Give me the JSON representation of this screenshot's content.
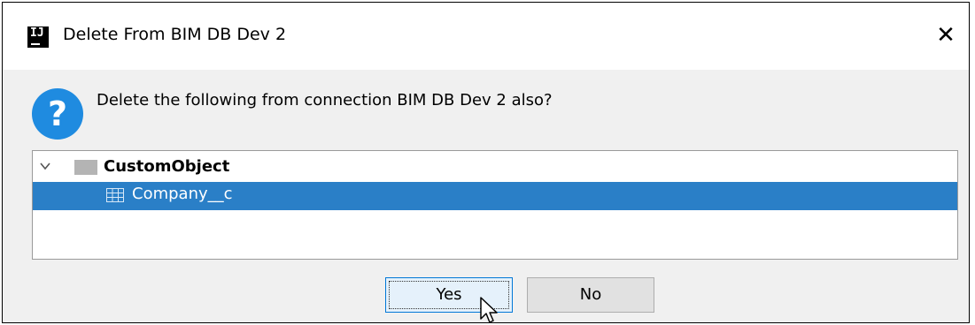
{
  "window": {
    "title": "Delete From BIM DB Dev 2",
    "app_icon_text": "IJ",
    "close_glyph": "✕"
  },
  "message": {
    "icon": "question-icon",
    "text": "Delete the following from connection BIM DB Dev 2 also?"
  },
  "tree": {
    "parent": {
      "icon": "folder-icon",
      "label": "CustomObject",
      "expanded": true
    },
    "child": {
      "icon": "table-icon",
      "label": "Company__c",
      "selected": true
    }
  },
  "buttons": {
    "yes": "Yes",
    "no": "No"
  },
  "colors": {
    "selection": "#2a7fc7",
    "question_icon": "#1f8be0",
    "default_button_border": "#0078d7"
  }
}
